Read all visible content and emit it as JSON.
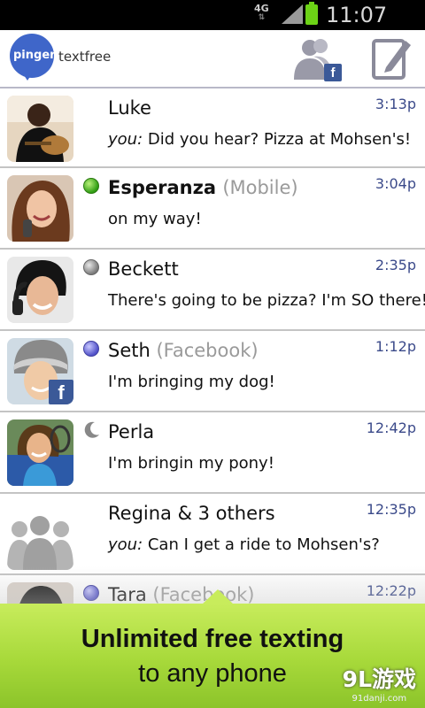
{
  "status_bar": {
    "network": "4G",
    "time": "11:07 AM"
  },
  "header": {
    "logo_word": "pinger",
    "app_name": "textfree"
  },
  "conversations": [
    {
      "name": "Luke",
      "name_suffix": "",
      "time": "3:13p",
      "prefix": "you:",
      "message": " Did you hear? Pizza at Mohsen's!",
      "status": "none",
      "bold": false
    },
    {
      "name": "Esperanza",
      "name_suffix": "(Mobile)",
      "time": "3:04p",
      "prefix": "",
      "message": "on my way!",
      "status": "green",
      "bold": true
    },
    {
      "name": "Beckett",
      "name_suffix": "",
      "time": "2:35p",
      "prefix": "",
      "message": "There's going to be pizza? I'm SO there!",
      "status": "gray",
      "bold": false
    },
    {
      "name": "Seth",
      "name_suffix": "(Facebook)",
      "time": "1:12p",
      "prefix": "",
      "message": "I'm bringing my dog!",
      "status": "blue",
      "bold": false
    },
    {
      "name": "Perla",
      "name_suffix": "",
      "time": "12:42p",
      "prefix": "",
      "message": "I'm bringin my pony!",
      "status": "moon",
      "bold": false
    },
    {
      "name": "Regina & 3 others",
      "name_suffix": "",
      "time": "12:35p",
      "prefix": "you:",
      "message": " Can I get a ride to Mohsen's?",
      "status": "none",
      "bold": false
    },
    {
      "name": "Tara",
      "name_suffix": "(Facebook)",
      "time": "12:22p",
      "prefix": "",
      "message": "",
      "status": "blue",
      "bold": false
    }
  ],
  "banner": {
    "title": "Unlimited free texting",
    "subtitle": "to any phone",
    "watermark": "9L游戏",
    "watermark_url": "91danji.com"
  },
  "colors": {
    "accent_blue": "#3b4a8a",
    "brand_blue": "#3f66c9",
    "banner_green": "#a7d93a",
    "facebook_blue": "#3b5998"
  }
}
